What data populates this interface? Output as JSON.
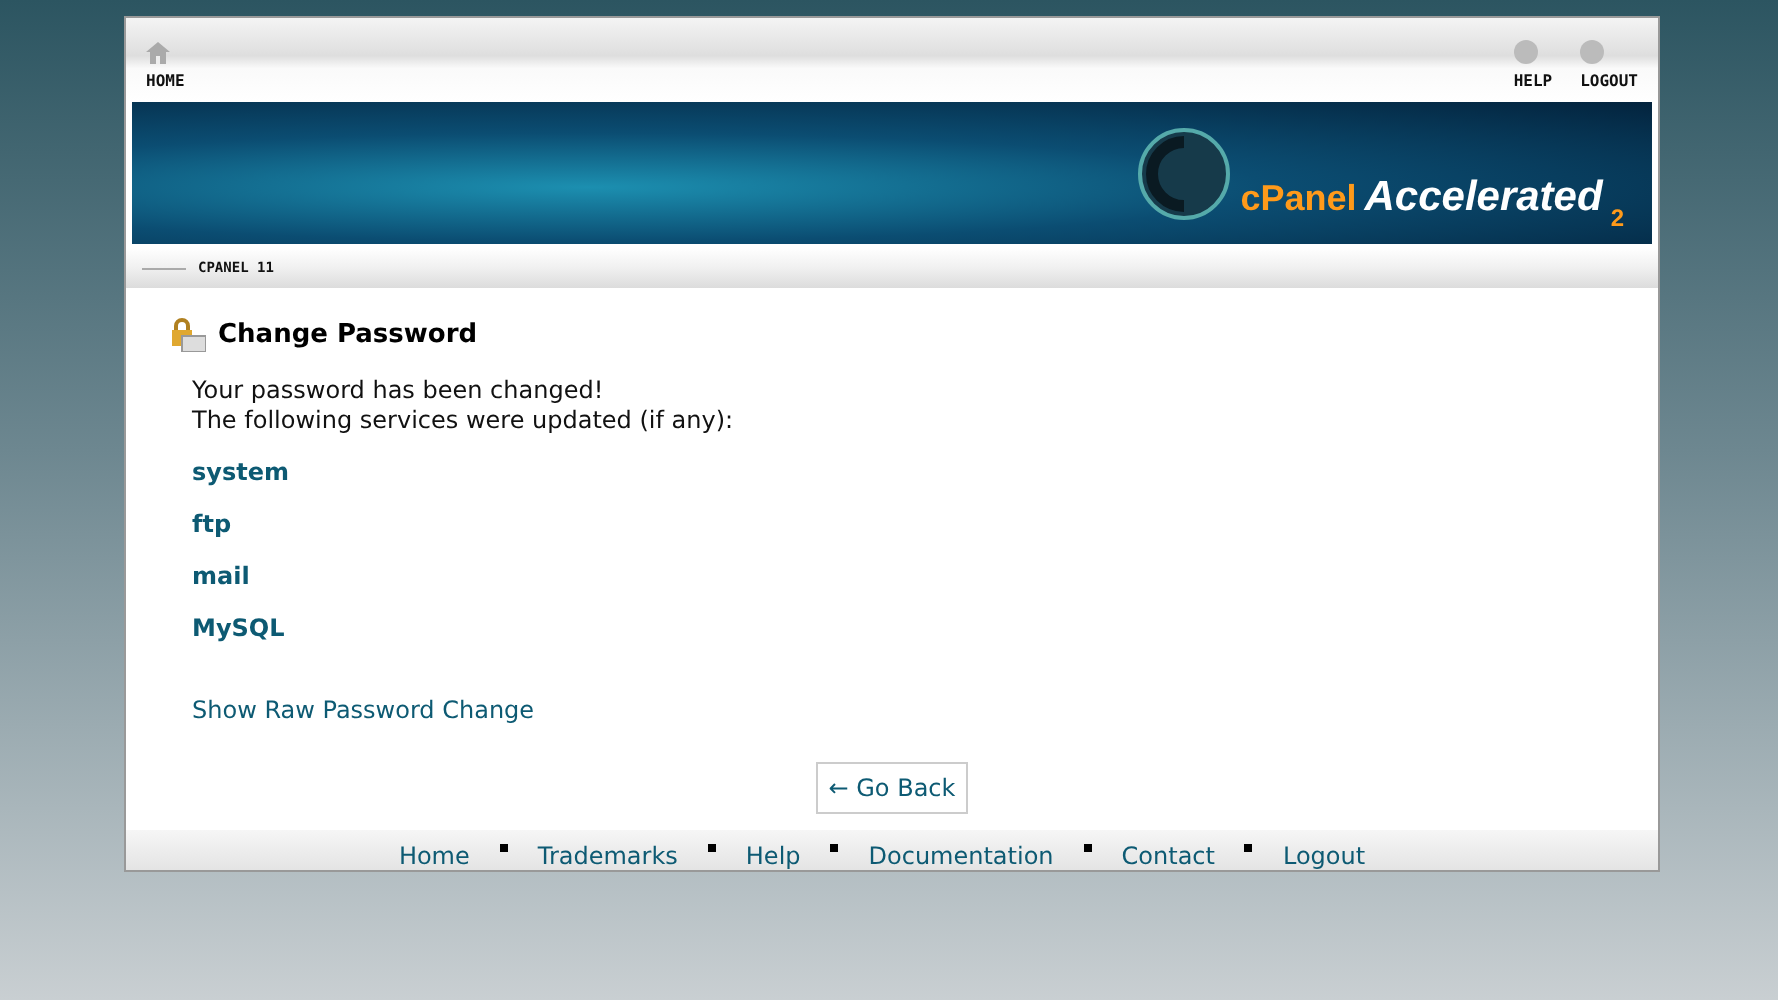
{
  "top_nav": {
    "home": "HOME",
    "links": [
      {
        "label": "HELP"
      },
      {
        "label": "LOGOUT"
      }
    ]
  },
  "banner": {
    "logo_brand": "cPanel",
    "logo_product": "Accelerated",
    "logo_version": "2"
  },
  "version_label": "CPANEL 11",
  "page": {
    "title": "Change Password",
    "messages": [
      "Your password has been changed!",
      "The following services were updated (if any):"
    ],
    "services": [
      "system",
      "ftp",
      "mail",
      "MySQL"
    ],
    "raw_link": "Show Raw Password Change",
    "back_button": "← Go Back"
  },
  "footer": {
    "links": [
      "Home",
      "Trademarks",
      "Help",
      "Documentation",
      "Contact",
      "Logout"
    ]
  }
}
